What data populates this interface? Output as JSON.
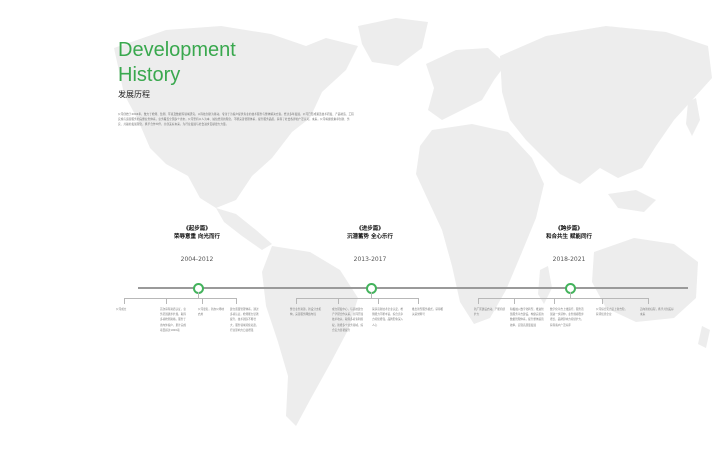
{
  "header": {
    "title_line1": "Development",
    "title_line2": "History",
    "subtitle": "发展历程",
    "intro": "公司创始于2004年，致力于检测、监测、环境及数据等领域研究，以科技创新为驱动，专注于为客户提供专业的技术服务与整体解决方案。经过多年发展，公司已形成涵盖技术研发、产品制造、工程实施与运营服务的完整业务体系，业务覆盖全国多个省市。公司坚持以人为本、诚信经营的理念，不断完善管理体系，提升服务品质，获得了社会各界的广泛认可。未来，公司将继续秉承创新、务实、共赢的发展理念，携手合作伙伴，共创美好未来，为行业发展与社会进步贡献更大力量。"
  },
  "phases": [
    {
      "name": "《起步篇》",
      "motto": "荣辱意重 向光而行",
      "period": "2004-2012",
      "events": [
        "公司成立",
        "首次获得资质认证，业务范围逐步扩展，取得多项检测资格，服务于省内外客户，累计完成项目超过1000项",
        "公司更名，新办公场地启用",
        "建立质量管理体系，通过多项认证，检测能力显著提升，技术团队不断壮大，服务领域持续拓宽，行业影响力日益增强"
      ]
    },
    {
      "name": "《进步篇》",
      "motto": "沉潜蓄势 全心乐行",
      "period": "2013-2017",
      "events": [
        "整合业务资源，新设分支机构，完善服务网络布局",
        "成立研发中心，与高校建立产学研合作关系，共同开展技术攻关，取得多项专利授权，新增多个业务领域，综合实力显著提升",
        "荣获高新技术企业认定，检测能力不断丰富，综合竞争力持续增强，品牌形象深入人心",
        "推出新型服务模式，获得相关荣誉称号"
      ]
    },
    {
      "name": "《跨步篇》",
      "motto": "和合共生 赋能同行",
      "period": "2018-2021",
      "events": [
        "新厂区建设启动，产能持续扩大",
        "积极融入数字化转型，推进智慧服务平台建设，构建完善的数据管理体系，提升整体运营效率，实现高质量发展",
        "数字化平台上线运行，服务范围进一步延伸，业务规模稳步增长，品牌影响力持续扩大，获得客户广泛好评",
        "公司综合实力迈上新台阶，获评优秀企业",
        "迈向新的征程，携手共创美好未来"
      ]
    }
  ],
  "colors": {
    "accent": "#39a84e",
    "map": "#ececec",
    "line": "#9a9a9a"
  }
}
